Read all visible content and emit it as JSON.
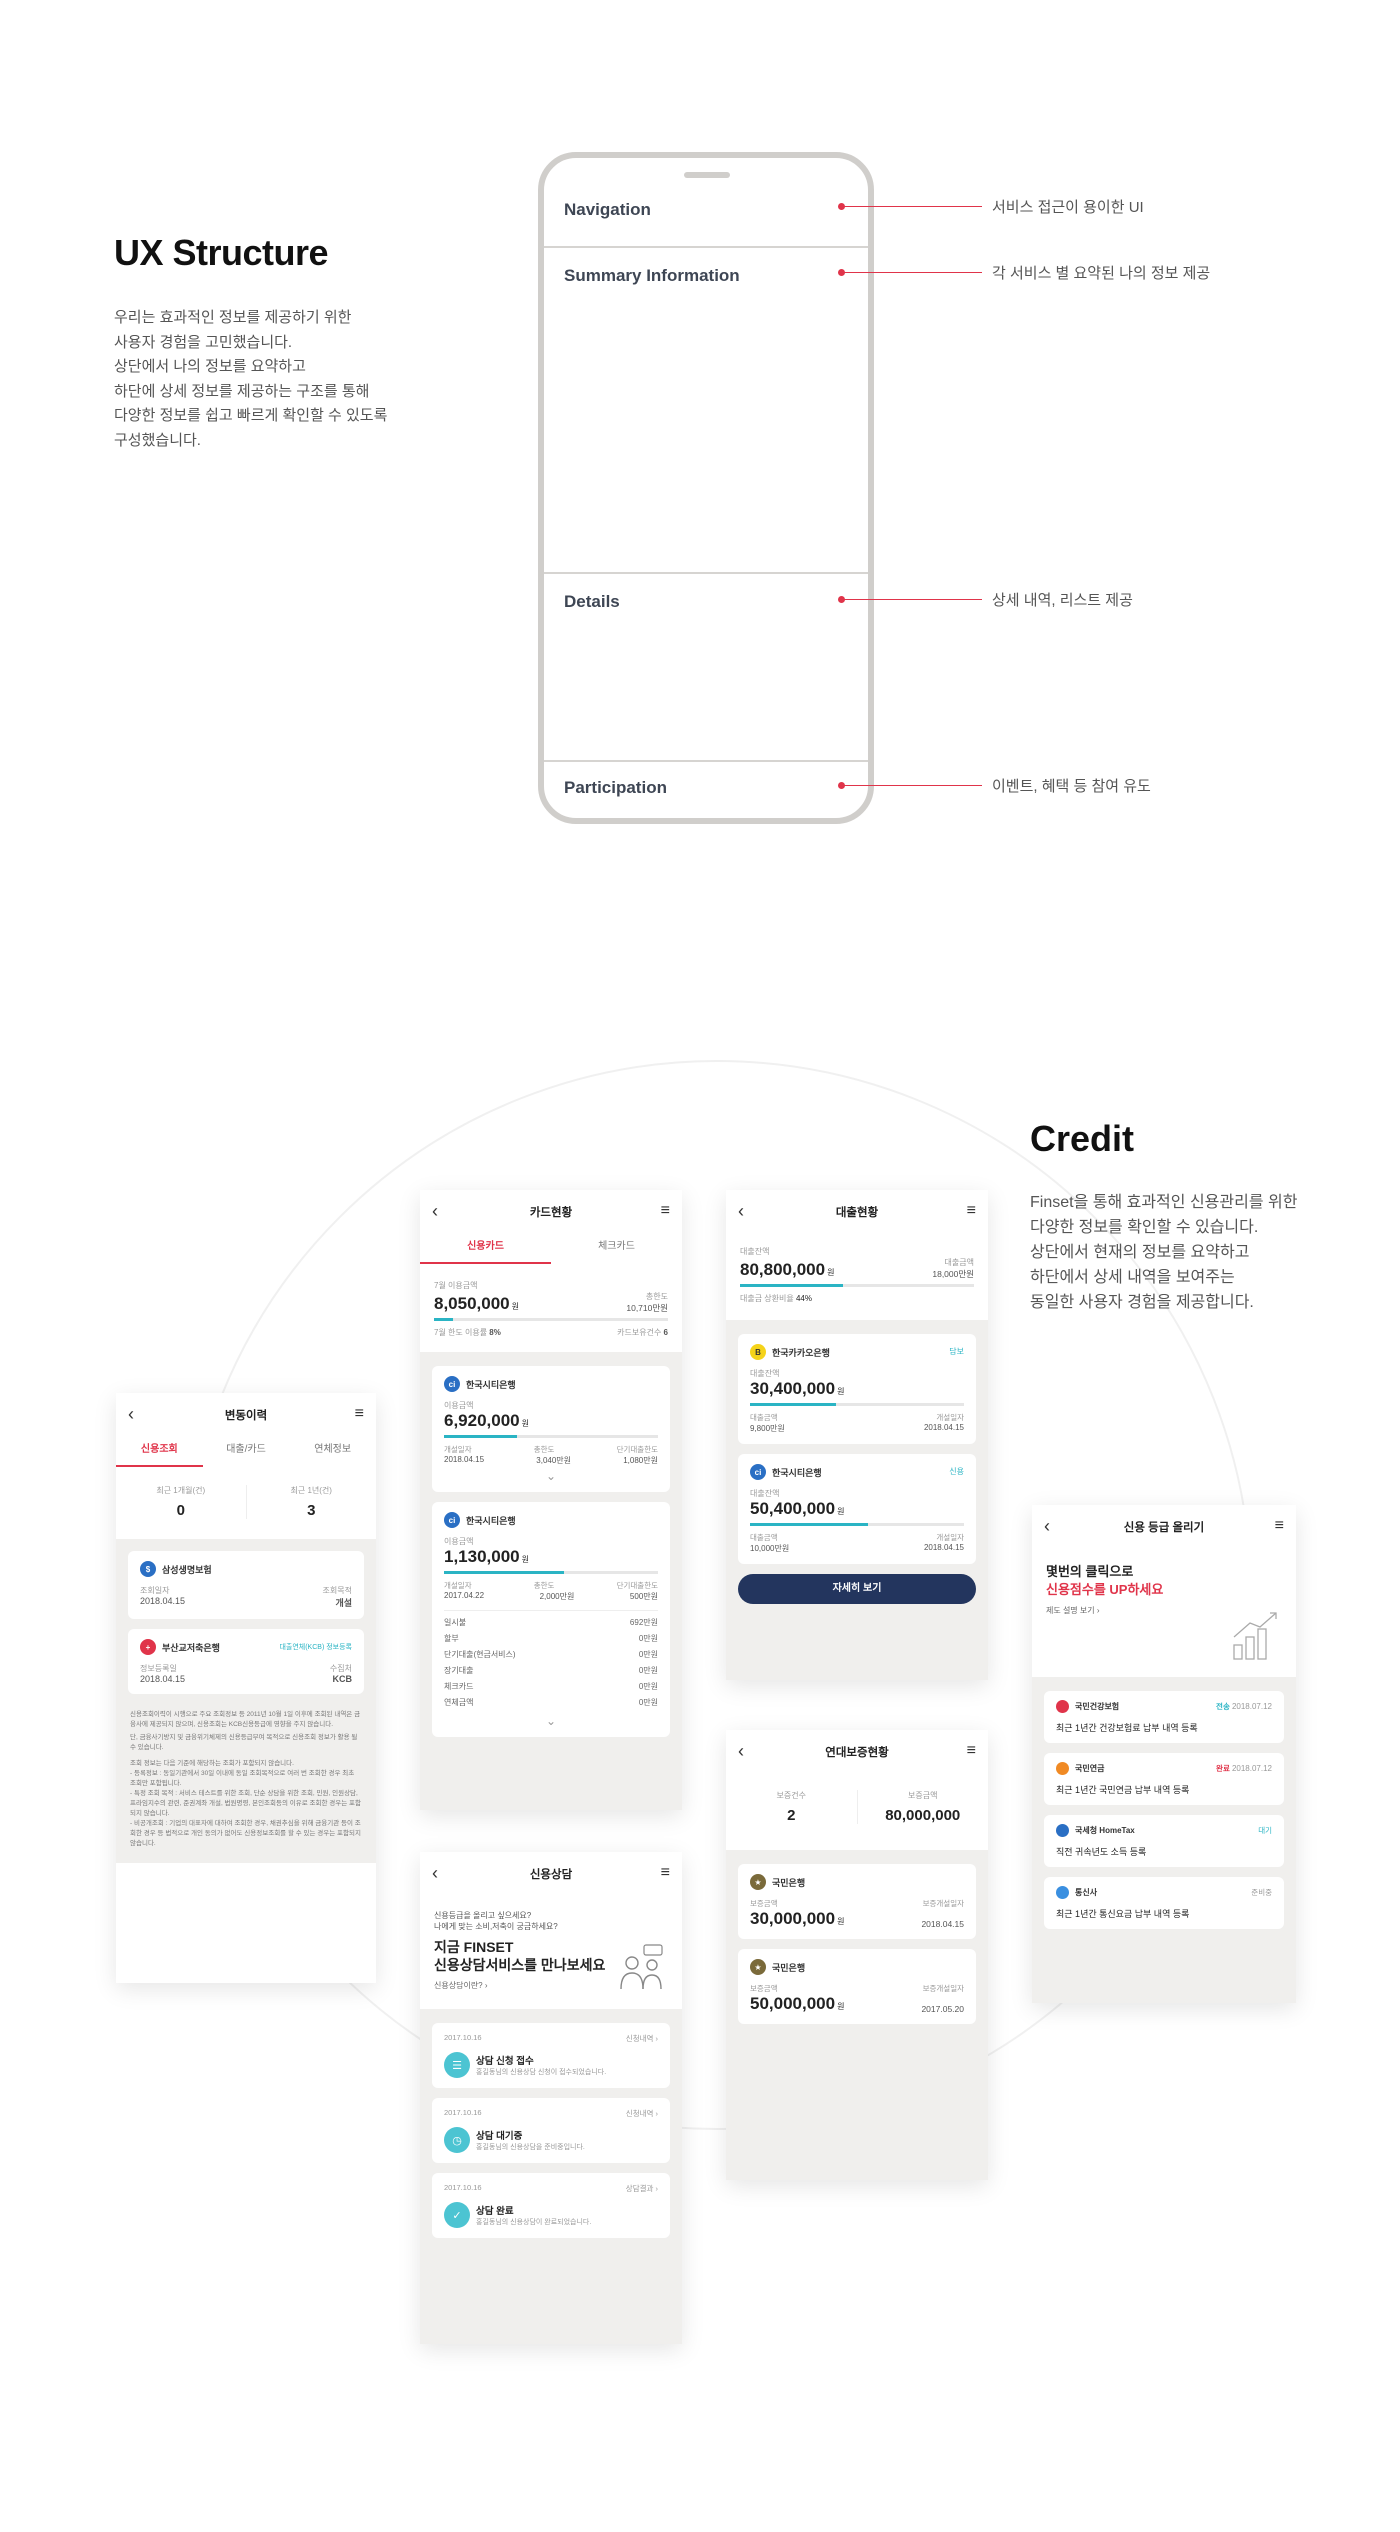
{
  "ux": {
    "title": "UX Structure",
    "desc": [
      "우리는 효과적인 정보를 제공하기 위한",
      "사용자 경험을 고민했습니다.",
      "상단에서 나의 정보를 요약하고",
      "하단에 상세 정보를 제공하는 구조를 통해",
      "다양한 정보를 쉽고 빠르게 확인할 수 있도록",
      "구성했습니다."
    ],
    "sections": {
      "navigation": "Navigation",
      "summary": "Summary Information",
      "details": "Details",
      "participation": "Participation"
    },
    "callouts": {
      "navigation": "서비스 접근이 용이한 UI",
      "summary": "각 서비스 별 요약된 나의 정보 제공",
      "details": "상세 내역, 리스트 제공",
      "participation": "이벤트, 혜택 등 참여 유도"
    }
  },
  "credit": {
    "title": "Credit",
    "desc": [
      "Finset을 통해 효과적인 신용관리를 위한",
      "다양한 정보를 확인할 수 있습니다.",
      "상단에서 현재의 정보를 요약하고",
      "하단에서 상세 내역을 보여주는",
      "동일한 사용자 경험을 제공합니다."
    ]
  },
  "history": {
    "title": "변동이력",
    "tabs": [
      "신용조회",
      "대출/카드",
      "연체정보"
    ],
    "stat1_label": "최근 1개월(건)",
    "stat1_value": "0",
    "stat2_label": "최근 1년(건)",
    "stat2_value": "3",
    "c1_name": "삼성생명보험",
    "c1_l1": "조회일자",
    "c1_l2": "조회목적",
    "c1_v1": "2018.04.15",
    "c1_v2": "개설",
    "c2_name": "부산교저축은행",
    "c2_tag": "대출연체(KCB) 정보등록",
    "c2_l1": "정보등록일",
    "c2_l2": "수집처",
    "c2_v1": "2018.04.15",
    "c2_v2": "KCB",
    "note1": "신용조회이력이 시행으로 주요 조회정보 등 2011년 10월 1일 이후에 조회된 내역은 금융사에 제공되지 않으며, 신용조회는 KCB신용등급에 영향을 주지 않습니다.",
    "note1b": "단, 금융사기방지 및 금융위기체제의 신용등급부여 목적으로 신용조회 정보가 활용 될 수 있습니다.",
    "note2": "조회 정보는 다음 기준에 해당하는 조회가 포함되지 않습니다.",
    "note2b": "- 등록정보 : 동일기관에서 30일 이내에 동일 조회목적으로 여러 번 조회한 경우 최초 조회만 포함됩니다.",
    "note2c": "- 특정 조회 목적 : 서비스 테스트를 위한 조회, 단순 상담을 위한 조회, 민원, 인원상담, 프라임지수의 관련, 준권계좌 개설, 법원명령, 본인조회등의 이유로 조회한 경우는 포함되지 않습니다.",
    "note2d": "- 비공개조회 : 기업의 대표자에 대하여 조회한 경우, 채권추심을 위해 금융기관 등이 조회한 경우 등 법적으로 개인 동의가 없어도 신용정보조회를 할 수 있는 경우는 포함되지 않습니다."
  },
  "cardstatus": {
    "title": "카드현황",
    "tabs": [
      "신용카드",
      "체크카드"
    ],
    "sum_label": "7월 이용금액",
    "sum_amt": "8,050,000",
    "won": "원",
    "total_label": "총한도",
    "total_val": "10,710만원",
    "rate_label": "7월 한도 이용률",
    "rate_val": "8%",
    "count_label": "카드보유건수",
    "count_val": "6",
    "rate_pct": 8,
    "c1_name": "한국시티은행",
    "c1_label": "이용금액",
    "c1_amt": "6,920,000",
    "c1_h": [
      "개설일자",
      "총한도",
      "단기대출한도"
    ],
    "c1_v": [
      "2018.04.15",
      "3,040만원",
      "1,080만원"
    ],
    "c1_pct": 34,
    "c2_name": "한국시티은행",
    "c2_label": "이용금액",
    "c2_amt": "1,130,000",
    "c2_h": [
      "개설일자",
      "총한도",
      "단기대출한도"
    ],
    "c2_v": [
      "2017.04.22",
      "2,000만원",
      "500만원"
    ],
    "c2_pct": 56,
    "c2_rows": [
      [
        "일시불",
        "692만원"
      ],
      [
        "할부",
        "0만원"
      ],
      [
        "단기대출(현금서비스)",
        "0만원"
      ],
      [
        "장기대출",
        "0만원"
      ],
      [
        "체크카드",
        "0만원"
      ],
      [
        "연체금액",
        "0만원"
      ]
    ]
  },
  "loan": {
    "title": "대출현황",
    "bal_label": "대출잔액",
    "bal_amt": "80,800,000",
    "won": "원",
    "orig_label": "대출금액",
    "orig_val": "18,000만원",
    "rate_label": "대출금 상환비율",
    "rate_val": "44%",
    "rate_pct": 44,
    "c1_name": "한국카카오은행",
    "c1_tag": "담보",
    "c1_label": "대출잔액",
    "c1_amt": "30,400,000",
    "c1_h": [
      "대출금액",
      "개설일자"
    ],
    "c1_v": [
      "9,800만원",
      "2018.04.15"
    ],
    "c1_pct": 40,
    "c2_name": "한국시티은행",
    "c2_tag": "신용",
    "c2_label": "대출잔액",
    "c2_amt": "50,400,000",
    "c2_h": [
      "대출금액",
      "개설일자"
    ],
    "c2_v": [
      "10,000만원",
      "2018.04.15"
    ],
    "c2_pct": 55,
    "more": "자세히 보기"
  },
  "guarantee": {
    "title": "연대보증현황",
    "s1_label": "보증건수",
    "s1_val": "2",
    "s2_label": "보증금액",
    "s2_val": "80,000,000",
    "c1_name": "국민은행",
    "c1_label": "보증금액",
    "c1_amt": "30,000,000",
    "c1_date_label": "보증개설일자",
    "c1_date": "2018.04.15",
    "c2_name": "국민은행",
    "c2_label": "보증금액",
    "c2_amt": "50,000,000",
    "c2_date_label": "보증개설일자",
    "c2_date": "2017.05.20",
    "won": "원"
  },
  "consult": {
    "title": "신용상담",
    "q1": "신용등급을 올리고 싶으세요?",
    "q2": "나에게 맞는 소비,저축이 궁금하세요?",
    "h1": "지금 FINSET",
    "h2": "신용상담서비스를 만나보세요",
    "link": "신용상담이란?",
    "items": [
      {
        "date": "2017.10.16",
        "link": "신청내역",
        "title": "상담 신청 접수",
        "desc": "홍길동님의 신용상담 신청이 접수되었습니다."
      },
      {
        "date": "2017.10.16",
        "link": "신청내역",
        "title": "상담 대기중",
        "desc": "홍길동님의 신용상담을 준비중입니다."
      },
      {
        "date": "2017.10.16",
        "link": "상담결과",
        "title": "상담 완료",
        "desc": "홍길동님의 신용상담이 완료되었습니다."
      }
    ]
  },
  "upgrade": {
    "title": "신용 등급 올리기",
    "h1": "몇번의 클릭으로",
    "h2": "신용점수를 UP하세요",
    "link": "제도 설명 보기",
    "items": [
      {
        "name": "국민건강보험",
        "status": "전송",
        "date": "2018.07.12",
        "desc": "최근 1년간 건강보험료 납부 내역 등록",
        "color": "#e0344a",
        "status_color": "#2ab4c4"
      },
      {
        "name": "국민연금",
        "status": "완료",
        "date": "2018.07.12",
        "desc": "최근 1년간 국민연금 납부 내역 등록",
        "color": "#f08a24",
        "status_color": "#e0344a"
      },
      {
        "name": "국세청 HomeTax",
        "status": "대기",
        "date": "",
        "desc": "직전 귀속년도 소득 등록",
        "color": "#2a6fc4",
        "status_color": "#2ab4c4"
      },
      {
        "name": "통신사",
        "status": "준비중",
        "date": "",
        "desc": "최근 1년간 통신요금 납부 내역 등록",
        "color": "#3a8fe0",
        "status_color": "#999999"
      }
    ]
  }
}
